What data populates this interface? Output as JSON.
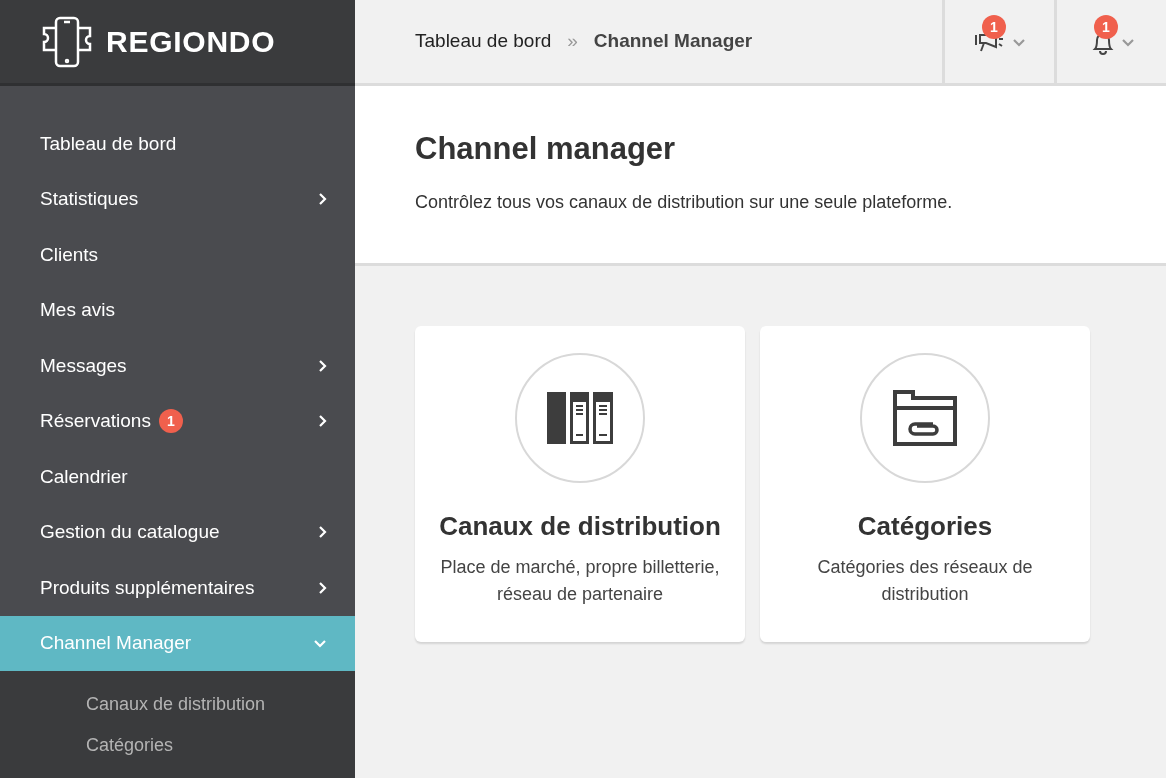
{
  "logo": {
    "text": "REGIONDO"
  },
  "breadcrumb": [
    {
      "label": "Tableau de bord"
    },
    {
      "label": "»"
    },
    {
      "label": "Channel Manager"
    }
  ],
  "header_actions": [
    {
      "kind": "megaphone",
      "badge": "1"
    },
    {
      "kind": "bell",
      "badge": "1"
    }
  ],
  "sidebar": {
    "items": [
      {
        "label": "Tableau de bord",
        "selected": false
      },
      {
        "label": "Statistiques",
        "selected": false,
        "expandable": true,
        "expanded": false
      },
      {
        "label": "Clients",
        "selected": false
      },
      {
        "label": "Mes avis",
        "selected": false
      },
      {
        "label": "Messages",
        "selected": false,
        "expandable": true,
        "expanded": false
      },
      {
        "label": "Réservations",
        "selected": false,
        "badge": "1",
        "expandable": true,
        "expanded": false
      },
      {
        "label": "Calendrier",
        "selected": false
      },
      {
        "label": "Gestion du catalogue",
        "selected": false,
        "expandable": true,
        "expanded": false
      },
      {
        "label": "Produits supplémentaires",
        "selected": false,
        "expandable": true,
        "expanded": false
      },
      {
        "label": "Channel Manager",
        "selected": true,
        "expandable": true,
        "expanded": true,
        "children": [
          {
            "label": "Canaux de distribution"
          },
          {
            "label": "Catégories"
          }
        ]
      }
    ]
  },
  "page": {
    "title": "Channel manager",
    "subtitle": "Contrôlez tous vos canaux de distribution sur une seule plateforme."
  },
  "cards": [
    {
      "kind": "binders",
      "title": "Canaux de distribution",
      "description": "Place de marché, propre billetterie, réseau de partenaire"
    },
    {
      "kind": "folder",
      "title": "Catégories",
      "description": "Catégories des réseaux de distribution"
    }
  ]
}
